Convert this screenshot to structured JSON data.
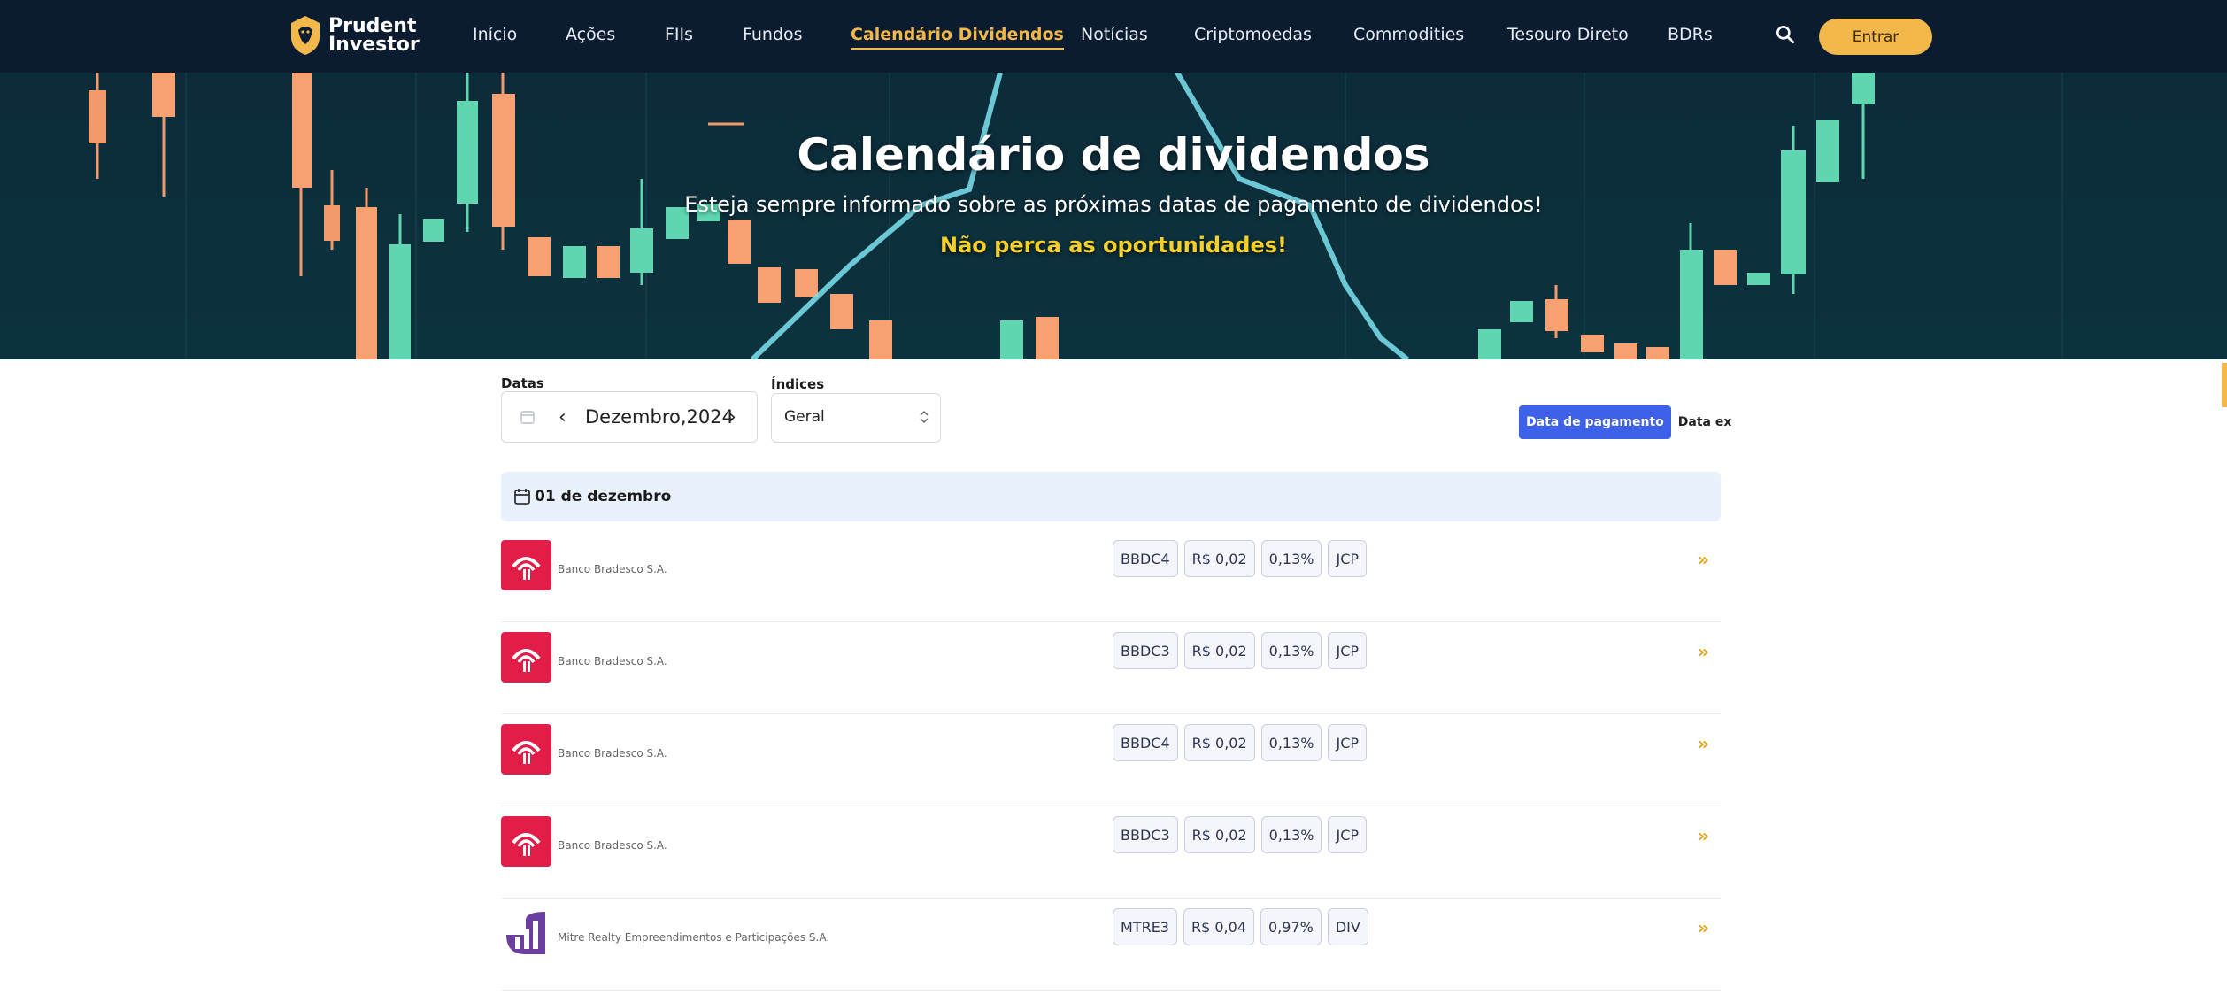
{
  "nav": {
    "logo_line1": "Prudent",
    "logo_line2": "Investor",
    "items": [
      "Início",
      "Ações",
      "FIIs",
      "Fundos",
      "Calendário Dividendos",
      "Notícias",
      "Criptomoedas",
      "Commodities",
      "Tesouro Direto",
      "BDRs"
    ],
    "active_index": 4,
    "login_label": "Entrar"
  },
  "hero": {
    "title": "Calendário de dividendos",
    "subtitle": "Esteja sempre informado sobre as próximas datas de pagamento de dividendos!",
    "cta": "Não perca as oportunidades!"
  },
  "filters": {
    "dates_label": "Datas",
    "date_value": "Dezembro,2024",
    "index_label": "Índices",
    "index_value": "Geral",
    "toggle": [
      "Data de pagamento",
      "Data ex"
    ],
    "toggle_active": 0
  },
  "list": {
    "day_label": "01 de dezembro",
    "rows": [
      {
        "company": "Banco Bradesco S.A.",
        "ticker": "BBDC4",
        "value": "R$ 0,02",
        "yield": "0,13%",
        "type": "JCP",
        "logo": "bradesco-logo"
      },
      {
        "company": "Banco Bradesco S.A.",
        "ticker": "BBDC3",
        "value": "R$ 0,02",
        "yield": "0,13%",
        "type": "JCP",
        "logo": "bradesco-logo"
      },
      {
        "company": "Banco Bradesco S.A.",
        "ticker": "BBDC4",
        "value": "R$ 0,02",
        "yield": "0,13%",
        "type": "JCP",
        "logo": "bradesco-logo"
      },
      {
        "company": "Banco Bradesco S.A.",
        "ticker": "BBDC3",
        "value": "R$ 0,02",
        "yield": "0,13%",
        "type": "JCP",
        "logo": "bradesco-logo"
      },
      {
        "company": "Mitre Realty Empreendimentos e Participações S.A.",
        "ticker": "MTRE3",
        "value": "R$ 0,04",
        "yield": "0,97%",
        "type": "DIV",
        "logo": "mitre-logo"
      }
    ]
  },
  "colors": {
    "nav_bg": "#0b1b30",
    "accent": "#f2b84b",
    "toggle_active": "#3d61e8",
    "bradesco_red": "#e11d48",
    "mitre_purple": "#6b3fa0"
  },
  "icons": [
    "search-icon",
    "calendar-icon",
    "chevron-left-icon",
    "chevron-right-icon",
    "updown-chevron-icon",
    "double-chevron-right-icon"
  ]
}
